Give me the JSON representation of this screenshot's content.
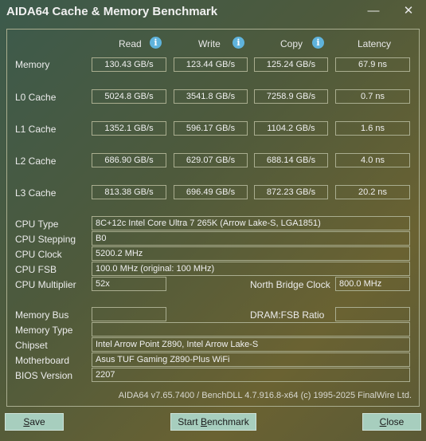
{
  "window": {
    "title": "AIDA64 Cache & Memory Benchmark"
  },
  "icons": {
    "minimize": "minimize-icon",
    "close": "close-icon",
    "info": "info-icon"
  },
  "columns": {
    "read": "Read",
    "write": "Write",
    "copy": "Copy",
    "latency": "Latency"
  },
  "rows": [
    {
      "label": "Memory",
      "read": "130.43 GB/s",
      "write": "123.44 GB/s",
      "copy": "125.24 GB/s",
      "latency": "67.9 ns"
    },
    {
      "label": "L0 Cache",
      "read": "5024.8 GB/s",
      "write": "3541.8 GB/s",
      "copy": "7258.9 GB/s",
      "latency": "0.7 ns"
    },
    {
      "label": "L1 Cache",
      "read": "1352.1 GB/s",
      "write": "596.17 GB/s",
      "copy": "1104.2 GB/s",
      "latency": "1.6 ns"
    },
    {
      "label": "L2 Cache",
      "read": "686.90 GB/s",
      "write": "629.07 GB/s",
      "copy": "688.14 GB/s",
      "latency": "4.0 ns"
    },
    {
      "label": "L3 Cache",
      "read": "813.38 GB/s",
      "write": "696.49 GB/s",
      "copy": "872.23 GB/s",
      "latency": "20.2 ns"
    }
  ],
  "cpu": {
    "type_label": "CPU Type",
    "type": "8C+12c Intel Core Ultra 7 265K  (Arrow Lake-S, LGA1851)",
    "stepping_label": "CPU Stepping",
    "stepping": "B0",
    "clock_label": "CPU Clock",
    "clock": "5200.2 MHz",
    "fsb_label": "CPU FSB",
    "fsb": "100.0 MHz  (original: 100 MHz)",
    "multiplier_label": "CPU Multiplier",
    "multiplier": "52x",
    "nb_clock_label": "North Bridge Clock",
    "nb_clock": "800.0 MHz"
  },
  "system": {
    "memory_bus_label": "Memory Bus",
    "memory_bus": "",
    "dram_ratio_label": "DRAM:FSB Ratio",
    "dram_ratio": "",
    "memory_type_label": "Memory Type",
    "memory_type": "",
    "chipset_label": "Chipset",
    "chipset": "Intel Arrow Point Z890, Intel Arrow Lake-S",
    "motherboard_label": "Motherboard",
    "motherboard": "Asus TUF Gaming Z890-Plus WiFi",
    "bios_label": "BIOS Version",
    "bios": "2207"
  },
  "footer": "AIDA64 v7.65.7400 / BenchDLL 4.7.916.8-x64  (c) 1995-2025 FinalWire Ltd.",
  "buttons": {
    "save_u": "S",
    "save_rest": "ave",
    "start_pre": "Start ",
    "start_u": "B",
    "start_rest": "enchmark",
    "close_u": "C",
    "close_rest": "lose"
  }
}
